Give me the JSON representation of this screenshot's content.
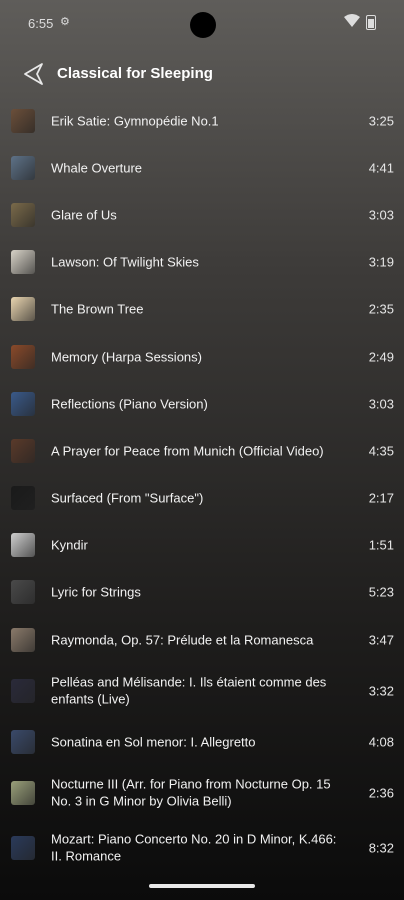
{
  "status": {
    "time": "6:55",
    "settings_icon": "gear-icon"
  },
  "header": {
    "title": "Classical for Sleeping",
    "back_icon": "back-triangle-icon"
  },
  "tracks": [
    {
      "title": "Erik Satie: Gymnopédie No.1",
      "duration": "3:25",
      "thumb_color": "#6b4f3a"
    },
    {
      "title": "Whale Overture",
      "duration": "4:41",
      "thumb_color": "#5e7288"
    },
    {
      "title": "Glare of Us",
      "duration": "3:03",
      "thumb_color": "#7a6a4a"
    },
    {
      "title": "Lawson: Of Twilight Skies",
      "duration": "3:19",
      "thumb_color": "#d8d3c8"
    },
    {
      "title": "The Brown Tree",
      "duration": "2:35",
      "thumb_color": "#e9d5b0"
    },
    {
      "title": "Memory (Harpa Sessions)",
      "duration": "2:49",
      "thumb_color": "#8a4a2a"
    },
    {
      "title": "Reflections (Piano Version)",
      "duration": "3:03",
      "thumb_color": "#3a5a8a"
    },
    {
      "title": "A Prayer for Peace from Munich (Official Video)",
      "duration": "4:35",
      "thumb_color": "#5a3a2a"
    },
    {
      "title": "Surfaced (From \"Surface\")",
      "duration": "2:17",
      "thumb_color": "#1a1a1a"
    },
    {
      "title": "Kyndir",
      "duration": "1:51",
      "thumb_color": "#cfcfcf"
    },
    {
      "title": "Lyric for Strings",
      "duration": "5:23",
      "thumb_color": "#4a4a4a"
    },
    {
      "title": "Raymonda, Op. 57: Prélude et la Romanesca",
      "duration": "3:47",
      "thumb_color": "#8a7a6a"
    },
    {
      "title": "Pelléas and Mélisande: I. Ils étaient comme des enfants (Live)",
      "duration": "3:32",
      "thumb_color": "#2a2a3a"
    },
    {
      "title": "Sonatina en Sol menor: I. Allegretto",
      "duration": "4:08",
      "thumb_color": "#3a4a6a"
    },
    {
      "title": "Nocturne III (Arr. for Piano from Nocturne Op. 15 No. 3 in G Minor by Olivia Belli)",
      "duration": "2:36",
      "thumb_color": "#9aa07a"
    },
    {
      "title": "Mozart: Piano Concerto No. 20 in D Minor, K.466: II. Romance",
      "duration": "8:32",
      "thumb_color": "#2a3a5a"
    }
  ]
}
